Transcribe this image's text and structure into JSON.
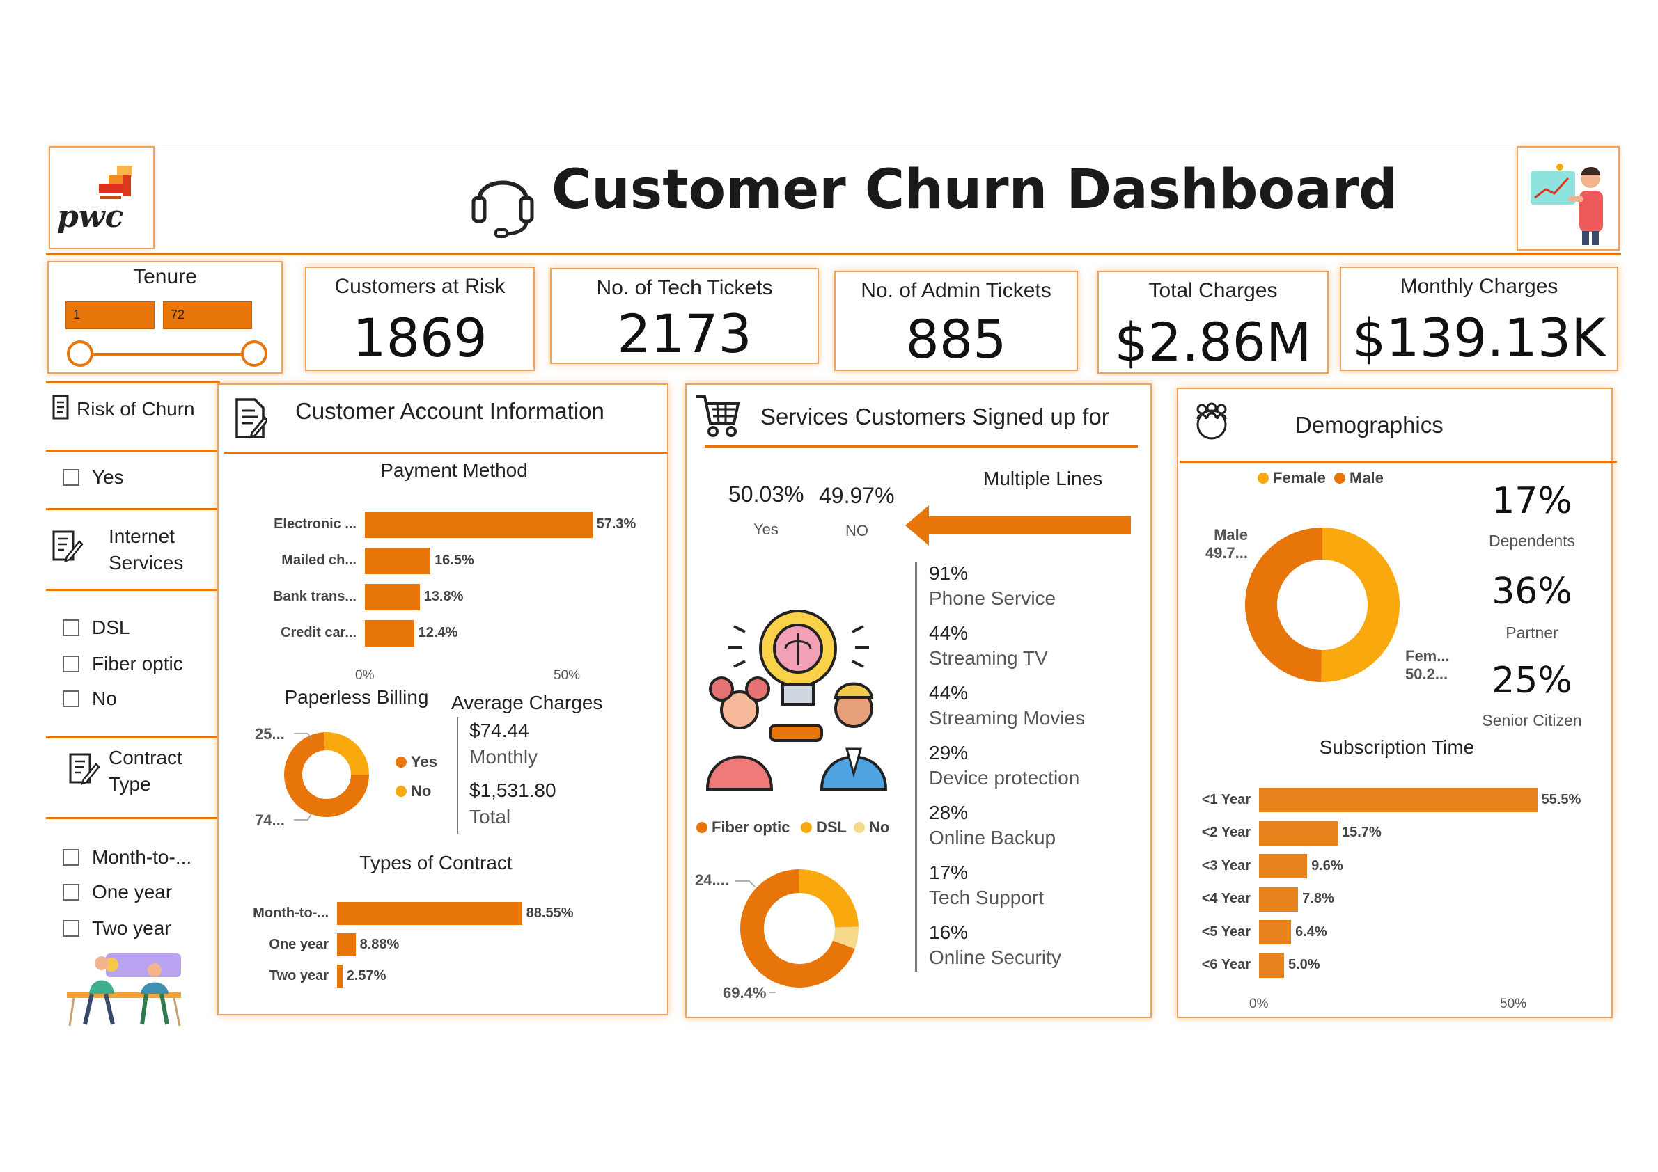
{
  "header": {
    "title": "Customer Churn Dashboard",
    "logo_text": "pwc"
  },
  "tenure": {
    "title": "Tenure",
    "min": "1",
    "max": "72"
  },
  "kpis": [
    {
      "title": "Customers at Risk",
      "value": "1869"
    },
    {
      "title": "No. of Tech Tickets",
      "value": "2173"
    },
    {
      "title": "No. of Admin Tickets",
      "value": "885"
    },
    {
      "title": "Total Charges",
      "value": "$2.86M"
    },
    {
      "title": "Monthly Charges",
      "value": "$139.13K"
    }
  ],
  "slicers": {
    "risk": {
      "title": "Risk of Churn",
      "options": [
        "Yes"
      ]
    },
    "internet": {
      "title_line1": "Internet",
      "title_line2": "Services",
      "options": [
        "DSL",
        "Fiber optic",
        "No"
      ]
    },
    "contract": {
      "title_line1": "Contract",
      "title_line2": "Type",
      "options": [
        "Month-to-...",
        "One year",
        "Two year"
      ]
    }
  },
  "account": {
    "title": "Customer Account Information",
    "payment_title": "Payment Method",
    "paperless_title": "Paperless Billing",
    "paperless_labels": {
      "top": "25...",
      "bottom": "74..."
    },
    "paperless_legend": [
      "Yes",
      "No"
    ],
    "avg_title": "Average Charges",
    "avg_monthly_value": "$74.44",
    "avg_monthly_label": "Monthly",
    "avg_total_value": "$1,531.80",
    "avg_total_label": "Total",
    "contract_title": "Types of Contract"
  },
  "services": {
    "title": "Services Customers Signed up for",
    "multiple_lines_title": "Multiple Lines",
    "yes_pct": "50.03%",
    "yes_label": "Yes",
    "no_pct": "49.97%",
    "no_label": "NO",
    "list": [
      {
        "pct": "91%",
        "name": "Phone Service"
      },
      {
        "pct": "44%",
        "name": "Streaming TV"
      },
      {
        "pct": "44%",
        "name": "Streaming Movies"
      },
      {
        "pct": "29%",
        "name": "Device protection"
      },
      {
        "pct": "28%",
        "name": "Online Backup"
      },
      {
        "pct": "17%",
        "name": "Tech Support"
      },
      {
        "pct": "16%",
        "name": "Online Security"
      }
    ],
    "internet_legend": [
      "Fiber optic",
      "DSL",
      "No"
    ],
    "internet_labels": {
      "top": "24....",
      "bottom": "69.4%"
    }
  },
  "demographics": {
    "title": "Demographics",
    "legend": [
      "Female",
      "Male"
    ],
    "male_label_line1": "Male",
    "male_label_line2": "49.7...",
    "female_label_line1": "Fem...",
    "female_label_line2": "50.2...",
    "stats": [
      {
        "value": "17%",
        "label": "Dependents"
      },
      {
        "value": "36%",
        "label": "Partner"
      },
      {
        "value": "25%",
        "label": "Senior Citizen"
      }
    ],
    "subscription_title": "Subscription Time"
  },
  "colors": {
    "orange": "#e8750a",
    "yellow": "#f9a90e",
    "light_yellow": "#f6d98a",
    "border": "#f0a35a"
  },
  "chart_data": [
    {
      "type": "bar",
      "title": "Payment Method",
      "orientation": "horizontal",
      "categories": [
        "Electronic ...",
        "Mailed ch...",
        "Bank trans...",
        "Credit car..."
      ],
      "values": [
        57.3,
        16.5,
        13.8,
        12.4
      ],
      "value_labels": [
        "57.3%",
        "16.5%",
        "13.8%",
        "12.4%"
      ],
      "xticks": [
        "0%",
        "50%"
      ]
    },
    {
      "type": "pie",
      "title": "Paperless Billing",
      "categories": [
        "Yes",
        "No"
      ],
      "values": [
        74,
        26
      ],
      "donut": true
    },
    {
      "type": "bar",
      "title": "Types of Contract",
      "orientation": "horizontal",
      "categories": [
        "Month-to-...",
        "One year",
        "Two year"
      ],
      "values": [
        88.55,
        8.88,
        2.57
      ],
      "value_labels": [
        "88.55%",
        "8.88%",
        "2.57%"
      ]
    },
    {
      "type": "pie",
      "title": "",
      "categories": [
        "Fiber optic",
        "DSL",
        "No"
      ],
      "values": [
        69.4,
        24.6,
        6.0
      ],
      "donut": true
    },
    {
      "type": "pie",
      "title": "",
      "categories": [
        "Female",
        "Male"
      ],
      "values": [
        50.25,
        49.75
      ],
      "donut": true
    },
    {
      "type": "bar",
      "title": "Subscription Time",
      "orientation": "horizontal",
      "categories": [
        "<1 Year",
        "<2 Year",
        "<3 Year",
        "<4 Year",
        "<5 Year",
        "<6 Year"
      ],
      "values": [
        55.5,
        15.7,
        9.6,
        7.8,
        6.4,
        5.0
      ],
      "value_labels": [
        "55.5%",
        "15.7%",
        "9.6%",
        "7.8%",
        "6.4%",
        "5.0%"
      ],
      "xticks": [
        "0%",
        "50%"
      ]
    }
  ]
}
